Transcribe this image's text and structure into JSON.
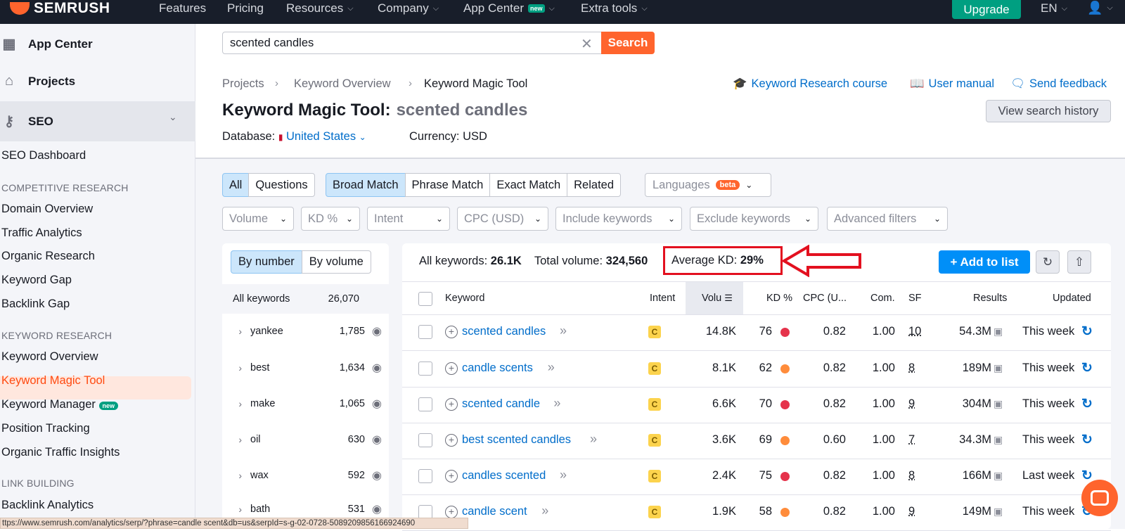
{
  "topbar": {
    "logo": "SEMRUSH",
    "nav": [
      "Features",
      "Pricing",
      "Resources",
      "Company",
      "App Center",
      "Extra tools"
    ],
    "new_badge": "new",
    "upgrade": "Upgrade",
    "lang": "EN"
  },
  "sidebar": {
    "app_center": "App Center",
    "projects": "Projects",
    "seo": "SEO",
    "seo_dashboard": "SEO Dashboard",
    "sec_competitive": "COMPETITIVE RESEARCH",
    "competitive": [
      "Domain Overview",
      "Traffic Analytics",
      "Organic Research",
      "Keyword Gap",
      "Backlink Gap"
    ],
    "sec_keyword": "KEYWORD RESEARCH",
    "keyword": [
      "Keyword Overview",
      "Keyword Magic Tool",
      "Keyword Manager",
      "Position Tracking",
      "Organic Traffic Insights"
    ],
    "keyword_manager_badge": "new",
    "sec_link": "LINK BUILDING",
    "link": [
      "Backlink Analytics"
    ]
  },
  "search": {
    "value": "scented candles",
    "button": "Search"
  },
  "breadcrumb": [
    "Projects",
    "Keyword Overview",
    "Keyword Magic Tool"
  ],
  "title": {
    "tool": "Keyword Magic Tool:",
    "query": "scented candles"
  },
  "header_links": [
    "Keyword Research course",
    "User manual",
    "Send feedback"
  ],
  "view_history": "View search history",
  "database": {
    "label": "Database:",
    "value": "United States",
    "currency": "Currency: USD"
  },
  "filters": {
    "type_tabs": [
      "All",
      "Questions"
    ],
    "match_tabs": [
      "Broad Match",
      "Phrase Match",
      "Exact Match",
      "Related"
    ],
    "languages": "Languages",
    "beta": "beta",
    "dropdowns": [
      "Volume",
      "KD %",
      "Intent",
      "CPC (USD)",
      "Include keywords",
      "Exclude keywords",
      "Advanced filters"
    ]
  },
  "groups": {
    "by_number": "By number",
    "by_volume": "By volume",
    "all_label": "All keywords",
    "all_count": "26,070",
    "rows": [
      {
        "name": "yankee",
        "count": "1,785"
      },
      {
        "name": "best",
        "count": "1,634"
      },
      {
        "name": "make",
        "count": "1,065"
      },
      {
        "name": "oil",
        "count": "630"
      },
      {
        "name": "wax",
        "count": "592"
      },
      {
        "name": "bath",
        "count": "531"
      }
    ]
  },
  "summary": {
    "all_keywords_label": "All keywords:",
    "all_keywords": "26.1K",
    "total_volume_label": "Total volume:",
    "total_volume": "324,560",
    "avg_kd_label": "Average KD:",
    "avg_kd": "29%"
  },
  "add_to_list": "+ Add to list",
  "columns": [
    "Keyword",
    "Intent",
    "Volu",
    "KD %",
    "CPC (U...",
    "Com.",
    "SF",
    "Results",
    "Updated"
  ],
  "rows": [
    {
      "kw": "scented candles",
      "intent": "C",
      "vol": "14.8K",
      "kd": "76",
      "kdc": "#e5334b",
      "cpc": "0.82",
      "com": "1.00",
      "sf": "10",
      "res": "54.3M",
      "upd": "This week"
    },
    {
      "kw": "candle scents",
      "intent": "C",
      "vol": "8.1K",
      "kd": "62",
      "kdc": "#ff8c3b",
      "cpc": "0.82",
      "com": "1.00",
      "sf": "8",
      "res": "189M",
      "upd": "This week"
    },
    {
      "kw": "scented candle",
      "intent": "C",
      "vol": "6.6K",
      "kd": "70",
      "kdc": "#e5334b",
      "cpc": "0.82",
      "com": "1.00",
      "sf": "9",
      "res": "304M",
      "upd": "This week"
    },
    {
      "kw": "best scented candles",
      "intent": "C",
      "vol": "3.6K",
      "kd": "69",
      "kdc": "#ff8c3b",
      "cpc": "0.60",
      "com": "1.00",
      "sf": "7",
      "res": "34.3M",
      "upd": "This week"
    },
    {
      "kw": "candles scented",
      "intent": "C",
      "vol": "2.4K",
      "kd": "75",
      "kdc": "#e5334b",
      "cpc": "0.82",
      "com": "1.00",
      "sf": "8",
      "res": "166M",
      "upd": "Last week"
    },
    {
      "kw": "candle scent",
      "intent": "C",
      "vol": "1.9K",
      "kd": "58",
      "kdc": "#ff8c3b",
      "cpc": "0.82",
      "com": "1.00",
      "sf": "9",
      "res": "149M",
      "upd": "This week"
    }
  ],
  "status_url": "ttps://www.semrush.com/analytics/serp/?phrase=candle scent&db=us&serpId=s-g-02-0728-5089209856166924690",
  "colors": {
    "brand": "#ff642d",
    "accent": "#008ff8",
    "upgrade": "#009f81",
    "highlight": "#e3101f"
  }
}
